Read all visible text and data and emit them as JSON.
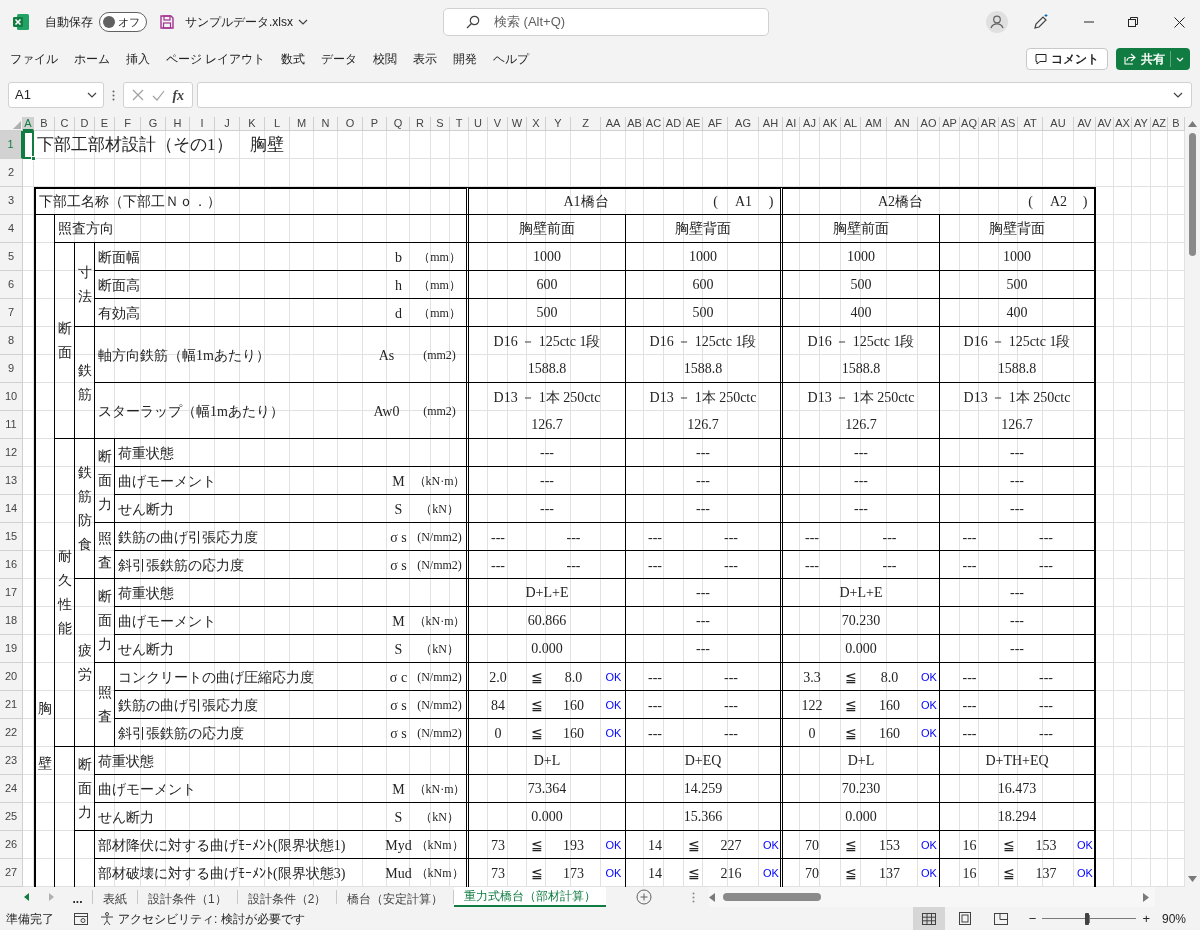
{
  "titlebar": {
    "autosave_label": "自動保存",
    "autosave": {
      "on": false,
      "label": "オフ"
    },
    "filename": "サンプルデータ.xlsx",
    "search_placeholder": "検索 (Alt+Q)"
  },
  "menu": [
    "ファイル",
    "ホーム",
    "挿入",
    "ページ レイアウト",
    "数式",
    "データ",
    "校閲",
    "表示",
    "開発",
    "ヘルプ"
  ],
  "comment_button": "コメント",
  "share_button": "共有",
  "formula_bar": {
    "name_box": "A1",
    "fx": "fx"
  },
  "columns": [
    {
      "label": "A",
      "selected": true
    },
    {
      "label": "B",
      "selected": false
    },
    {
      "label": "C",
      "selected": false
    },
    {
      "label": "D",
      "selected": false
    },
    {
      "label": "E",
      "selected": false
    },
    {
      "label": "F",
      "selected": false
    },
    {
      "label": "G",
      "selected": false
    },
    {
      "label": "H",
      "selected": false
    },
    {
      "label": "I",
      "selected": false
    },
    {
      "label": "J",
      "selected": false
    },
    {
      "label": "K",
      "selected": false
    },
    {
      "label": "L",
      "selected": false
    },
    {
      "label": "M",
      "selected": false
    },
    {
      "label": "N",
      "selected": false
    },
    {
      "label": "O",
      "selected": false
    },
    {
      "label": "P",
      "selected": false
    },
    {
      "label": "Q",
      "selected": false
    },
    {
      "label": "R",
      "selected": false
    },
    {
      "label": "S",
      "selected": false
    },
    {
      "label": "T",
      "selected": false
    },
    {
      "label": "U",
      "selected": false
    },
    {
      "label": "V",
      "selected": false
    },
    {
      "label": "W",
      "selected": false
    },
    {
      "label": "X",
      "selected": false
    },
    {
      "label": "Y",
      "selected": false
    },
    {
      "label": "Z",
      "selected": false
    },
    {
      "label": "AA",
      "selected": false
    },
    {
      "label": "AB",
      "selected": false
    },
    {
      "label": "AC",
      "selected": false
    },
    {
      "label": "AD",
      "selected": false
    },
    {
      "label": "AE",
      "selected": false
    },
    {
      "label": "AF",
      "selected": false
    },
    {
      "label": "AG",
      "selected": false
    },
    {
      "label": "AH",
      "selected": false
    },
    {
      "label": "AI",
      "selected": false
    },
    {
      "label": "AJ",
      "selected": false
    },
    {
      "label": "AK",
      "selected": false
    },
    {
      "label": "AL",
      "selected": false
    },
    {
      "label": "AM",
      "selected": false
    },
    {
      "label": "AN",
      "selected": false
    },
    {
      "label": "AO",
      "selected": false
    },
    {
      "label": "AP",
      "selected": false
    },
    {
      "label": "AQ",
      "selected": false
    },
    {
      "label": "AR",
      "selected": false
    },
    {
      "label": "AS",
      "selected": false
    },
    {
      "label": "AT",
      "selected": false
    },
    {
      "label": "AU",
      "selected": false
    },
    {
      "label": "AV",
      "selected": false
    },
    {
      "label": "AV",
      "selected": false
    },
    {
      "label": "AX",
      "selected": false
    },
    {
      "label": "AY",
      "selected": false
    },
    {
      "label": "AZ",
      "selected": false
    },
    {
      "label": "B",
      "selected": false
    }
  ],
  "rows": [
    {
      "label": "1",
      "selected": true
    },
    {
      "label": "2",
      "selected": false
    },
    {
      "label": "3",
      "selected": false
    },
    {
      "label": "4",
      "selected": false
    },
    {
      "label": "5",
      "selected": false
    },
    {
      "label": "6",
      "selected": false
    },
    {
      "label": "7",
      "selected": false
    },
    {
      "label": "8",
      "selected": false
    },
    {
      "label": "9",
      "selected": false
    },
    {
      "label": "10",
      "selected": false
    },
    {
      "label": "11",
      "selected": false
    },
    {
      "label": "12",
      "selected": false
    },
    {
      "label": "13",
      "selected": false
    },
    {
      "label": "14",
      "selected": false
    },
    {
      "label": "15",
      "selected": false
    },
    {
      "label": "16",
      "selected": false
    },
    {
      "label": "17",
      "selected": false
    },
    {
      "label": "18",
      "selected": false
    },
    {
      "label": "19",
      "selected": false
    },
    {
      "label": "20",
      "selected": false
    },
    {
      "label": "21",
      "selected": false
    },
    {
      "label": "22",
      "selected": false
    },
    {
      "label": "23",
      "selected": false
    },
    {
      "label": "24",
      "selected": false
    },
    {
      "label": "25",
      "selected": false
    },
    {
      "label": "26",
      "selected": false
    },
    {
      "label": "27",
      "selected": false
    }
  ],
  "sheet": {
    "title": "下部工部材設計（その1）　胸壁",
    "name_header": "下部工名称（下部工Ｎｏ．）",
    "piers": [
      {
        "name": "A1橋台",
        "open": "(",
        "number": "A1",
        "close": ")"
      },
      {
        "name": "A2橋台",
        "open": "(",
        "number": "A2",
        "close": ")"
      }
    ],
    "side_label": "胸壁",
    "direction": {
      "label": "照査方向",
      "values": [
        "胸壁前面",
        "胸壁背面",
        "胸壁前面",
        "胸壁背面"
      ]
    },
    "sections": [
      {
        "label": "断面",
        "groups": [
          {
            "label": "寸法",
            "rows": [
              {
                "label": "断面幅",
                "symbol": "b",
                "unit": "（mm）",
                "cells": [
                  {
                    "kind": "text",
                    "text": "1000"
                  },
                  {
                    "kind": "text",
                    "text": "1000"
                  },
                  {
                    "kind": "text",
                    "text": "1000"
                  },
                  {
                    "kind": "text",
                    "text": "1000"
                  }
                ]
              },
              {
                "label": "断面高",
                "symbol": "h",
                "unit": "（mm）",
                "cells": [
                  {
                    "kind": "text",
                    "text": "600"
                  },
                  {
                    "kind": "text",
                    "text": "600"
                  },
                  {
                    "kind": "text",
                    "text": "500"
                  },
                  {
                    "kind": "text",
                    "text": "500"
                  }
                ]
              },
              {
                "label": "有効高",
                "symbol": "d",
                "unit": "（mm）",
                "cells": [
                  {
                    "kind": "text",
                    "text": "500"
                  },
                  {
                    "kind": "text",
                    "text": "500"
                  },
                  {
                    "kind": "text",
                    "text": "400"
                  },
                  {
                    "kind": "text",
                    "text": "400"
                  }
                ]
              }
            ]
          },
          {
            "label": "鉄筋",
            "rows": [
              {
                "label": "軸方向鉄筋（幅1mあたり）",
                "symbol": "As",
                "unit": "(mm2)",
                "cells": [
                  {
                    "kind": "two_line",
                    "lines": [
                      "D16 － 125ctc 1段",
                      "1588.8"
                    ]
                  },
                  {
                    "kind": "two_line",
                    "lines": [
                      "D16 － 125ctc 1段",
                      "1588.8"
                    ]
                  },
                  {
                    "kind": "two_line",
                    "lines": [
                      "D16 － 125ctc 1段",
                      "1588.8"
                    ]
                  },
                  {
                    "kind": "two_line",
                    "lines": [
                      "D16 － 125ctc 1段",
                      "1588.8"
                    ]
                  }
                ]
              },
              {
                "label": "スターラップ（幅1mあたり）",
                "symbol": "Aw0",
                "unit": "(mm2)",
                "cells": [
                  {
                    "kind": "two_line",
                    "lines": [
                      "D13 － 1本 250ctc",
                      "126.7"
                    ]
                  },
                  {
                    "kind": "two_line",
                    "lines": [
                      "D13 － 1本 250ctc",
                      "126.7"
                    ]
                  },
                  {
                    "kind": "two_line",
                    "lines": [
                      "D13 － 1本 250ctc",
                      "126.7"
                    ]
                  },
                  {
                    "kind": "two_line",
                    "lines": [
                      "D13 － 1本 250ctc",
                      "126.7"
                    ]
                  }
                ]
              }
            ]
          }
        ]
      },
      {
        "label": "耐久性能",
        "groups": [
          {
            "label": "鉄筋防食",
            "subgroups": [
              {
                "label": "断面力",
                "rows": [
                  {
                    "label": "荷重状態",
                    "cells": [
                      {
                        "kind": "text",
                        "text": "---"
                      },
                      {
                        "kind": "text",
                        "text": "---"
                      },
                      {
                        "kind": "text",
                        "text": "---"
                      },
                      {
                        "kind": "text",
                        "text": "---"
                      }
                    ]
                  },
                  {
                    "label": "曲げモーメント",
                    "symbol": "M",
                    "unit": "（kN·m）",
                    "cells": [
                      {
                        "kind": "text",
                        "text": "---"
                      },
                      {
                        "kind": "text",
                        "text": "---"
                      },
                      {
                        "kind": "text",
                        "text": "---"
                      },
                      {
                        "kind": "text",
                        "text": "---"
                      }
                    ]
                  },
                  {
                    "label": "せん断力",
                    "symbol": "S",
                    "unit": "（kN）",
                    "cells": [
                      {
                        "kind": "text",
                        "text": "---"
                      },
                      {
                        "kind": "text",
                        "text": "---"
                      },
                      {
                        "kind": "text",
                        "text": "---"
                      },
                      {
                        "kind": "text",
                        "text": "---"
                      }
                    ]
                  }
                ]
              },
              {
                "label": "照査",
                "rows": [
                  {
                    "label": "鉄筋の曲げ引張応力度",
                    "symbol": "σ s",
                    "unit": "(N/mm2)",
                    "cells": [
                      {
                        "kind": "pair",
                        "value": "---",
                        "limit": "---"
                      },
                      {
                        "kind": "pair",
                        "value": "---",
                        "limit": "---"
                      },
                      {
                        "kind": "pair",
                        "value": "---",
                        "limit": "---"
                      },
                      {
                        "kind": "pair",
                        "value": "---",
                        "limit": "---"
                      }
                    ]
                  },
                  {
                    "label": "斜引張鉄筋の応力度",
                    "symbol": "σ s",
                    "unit": "(N/mm2)",
                    "cells": [
                      {
                        "kind": "pair",
                        "value": "---",
                        "limit": "---"
                      },
                      {
                        "kind": "pair",
                        "value": "---",
                        "limit": "---"
                      },
                      {
                        "kind": "pair",
                        "value": "---",
                        "limit": "---"
                      },
                      {
                        "kind": "pair",
                        "value": "---",
                        "limit": "---"
                      }
                    ]
                  }
                ]
              }
            ]
          },
          {
            "label": "疲労",
            "subgroups": [
              {
                "label": "断面力",
                "rows": [
                  {
                    "label": "荷重状態",
                    "cells": [
                      {
                        "kind": "text",
                        "text": "D+L+E"
                      },
                      {
                        "kind": "text",
                        "text": "---"
                      },
                      {
                        "kind": "text",
                        "text": "D+L+E"
                      },
                      {
                        "kind": "text",
                        "text": "---"
                      }
                    ]
                  },
                  {
                    "label": "曲げモーメント",
                    "symbol": "M",
                    "unit": "（kN·m）",
                    "cells": [
                      {
                        "kind": "text",
                        "text": "60.866"
                      },
                      {
                        "kind": "text",
                        "text": "---"
                      },
                      {
                        "kind": "text",
                        "text": "70.230"
                      },
                      {
                        "kind": "text",
                        "text": "---"
                      }
                    ]
                  },
                  {
                    "label": "せん断力",
                    "symbol": "S",
                    "unit": "（kN）",
                    "cells": [
                      {
                        "kind": "text",
                        "text": "0.000"
                      },
                      {
                        "kind": "text",
                        "text": "---"
                      },
                      {
                        "kind": "text",
                        "text": "0.000"
                      },
                      {
                        "kind": "text",
                        "text": "---"
                      }
                    ]
                  }
                ]
              },
              {
                "label": "照査",
                "rows": [
                  {
                    "label": "コンクリートの曲げ圧縮応力度",
                    "symbol": "σ c",
                    "unit": "(N/mm2)",
                    "cells": [
                      {
                        "kind": "check",
                        "value": "2.0",
                        "op": "≦",
                        "limit": "8.0",
                        "result": "OK"
                      },
                      {
                        "kind": "pair",
                        "value": "---",
                        "limit": "---"
                      },
                      {
                        "kind": "check",
                        "value": "3.3",
                        "op": "≦",
                        "limit": "8.0",
                        "result": "OK"
                      },
                      {
                        "kind": "pair",
                        "value": "---",
                        "limit": "---"
                      }
                    ]
                  },
                  {
                    "label": "鉄筋の曲げ引張応力度",
                    "symbol": "σ s",
                    "unit": "(N/mm2)",
                    "cells": [
                      {
                        "kind": "check",
                        "value": "84",
                        "op": "≦",
                        "limit": "160",
                        "result": "OK"
                      },
                      {
                        "kind": "pair",
                        "value": "---",
                        "limit": "---"
                      },
                      {
                        "kind": "check",
                        "value": "122",
                        "op": "≦",
                        "limit": "160",
                        "result": "OK"
                      },
                      {
                        "kind": "pair",
                        "value": "---",
                        "limit": "---"
                      }
                    ]
                  },
                  {
                    "label": "斜引張鉄筋の応力度",
                    "symbol": "σ s",
                    "unit": "(N/mm2)",
                    "cells": [
                      {
                        "kind": "check",
                        "value": "0",
                        "op": "≦",
                        "limit": "160",
                        "result": "OK"
                      },
                      {
                        "kind": "pair",
                        "value": "---",
                        "limit": "---"
                      },
                      {
                        "kind": "check",
                        "value": "0",
                        "op": "≦",
                        "limit": "160",
                        "result": "OK"
                      },
                      {
                        "kind": "pair",
                        "value": "---",
                        "limit": "---"
                      }
                    ]
                  }
                ]
              }
            ]
          }
        ]
      },
      {
        "groups": [
          {
            "label": "断面力",
            "rows": [
              {
                "label": "荷重状態",
                "cells": [
                  {
                    "kind": "text",
                    "text": "D+L"
                  },
                  {
                    "kind": "text",
                    "text": "D+EQ"
                  },
                  {
                    "kind": "text",
                    "text": "D+L"
                  },
                  {
                    "kind": "text",
                    "text": "D+TH+EQ"
                  }
                ]
              },
              {
                "label": "曲げモーメント",
                "symbol": "M",
                "unit": "（kN·m）",
                "cells": [
                  {
                    "kind": "text",
                    "text": "73.364"
                  },
                  {
                    "kind": "text",
                    "text": "14.259"
                  },
                  {
                    "kind": "text",
                    "text": "70.230"
                  },
                  {
                    "kind": "text",
                    "text": "16.473"
                  }
                ]
              },
              {
                "label": "せん断力",
                "symbol": "S",
                "unit": "（kN）",
                "cells": [
                  {
                    "kind": "text",
                    "text": "0.000"
                  },
                  {
                    "kind": "text",
                    "text": "15.366"
                  },
                  {
                    "kind": "text",
                    "text": "0.000"
                  },
                  {
                    "kind": "text",
                    "text": "18.294"
                  }
                ]
              }
            ]
          },
          {
            "rows": [
              {
                "label": "部材降伏に対する曲げﾓｰﾒﾝﾄ(限界状態1)",
                "symbol": "Myd",
                "unit": "（kNm）",
                "cells": [
                  {
                    "kind": "check",
                    "value": "73",
                    "op": "≦",
                    "limit": "193",
                    "result": "OK"
                  },
                  {
                    "kind": "check",
                    "value": "14",
                    "op": "≦",
                    "limit": "227",
                    "result": "OK"
                  },
                  {
                    "kind": "check",
                    "value": "70",
                    "op": "≦",
                    "limit": "153",
                    "result": "OK"
                  },
                  {
                    "kind": "check",
                    "value": "16",
                    "op": "≦",
                    "limit": "153",
                    "result": "OK"
                  }
                ]
              },
              {
                "label": "部材破壊に対する曲げﾓｰﾒﾝﾄ(限界状態3)",
                "symbol": "Mud",
                "unit": "（kNm）",
                "cells": [
                  {
                    "kind": "check",
                    "value": "73",
                    "op": "≦",
                    "limit": "173",
                    "result": "OK"
                  },
                  {
                    "kind": "check",
                    "value": "14",
                    "op": "≦",
                    "limit": "216",
                    "result": "OK"
                  },
                  {
                    "kind": "check",
                    "value": "70",
                    "op": "≦",
                    "limit": "137",
                    "result": "OK"
                  },
                  {
                    "kind": "check",
                    "value": "16",
                    "op": "≦",
                    "limit": "137",
                    "result": "OK"
                  }
                ]
              }
            ]
          }
        ]
      }
    ]
  },
  "sheet_tabs": {
    "more": "...",
    "tabs": [
      {
        "label": "表紙",
        "selected": false
      },
      {
        "label": "設計条件（1）",
        "selected": false
      },
      {
        "label": "設計条件（2）",
        "selected": false
      },
      {
        "label": "橋台（安定計算）",
        "selected": false
      },
      {
        "label": "重力式橋台（部材計算）",
        "selected": true
      }
    ]
  },
  "status_bar": {
    "ready": "準備完了",
    "accessibility": "アクセシビリティ: 検討が必要です",
    "views": [
      {
        "kind": "normal",
        "selected": true
      },
      {
        "kind": "page_layout",
        "selected": false
      },
      {
        "kind": "page_break",
        "selected": false
      }
    ],
    "zoom": {
      "minus": "−",
      "plus": "+",
      "level": 0.45,
      "reading": "90%"
    }
  }
}
